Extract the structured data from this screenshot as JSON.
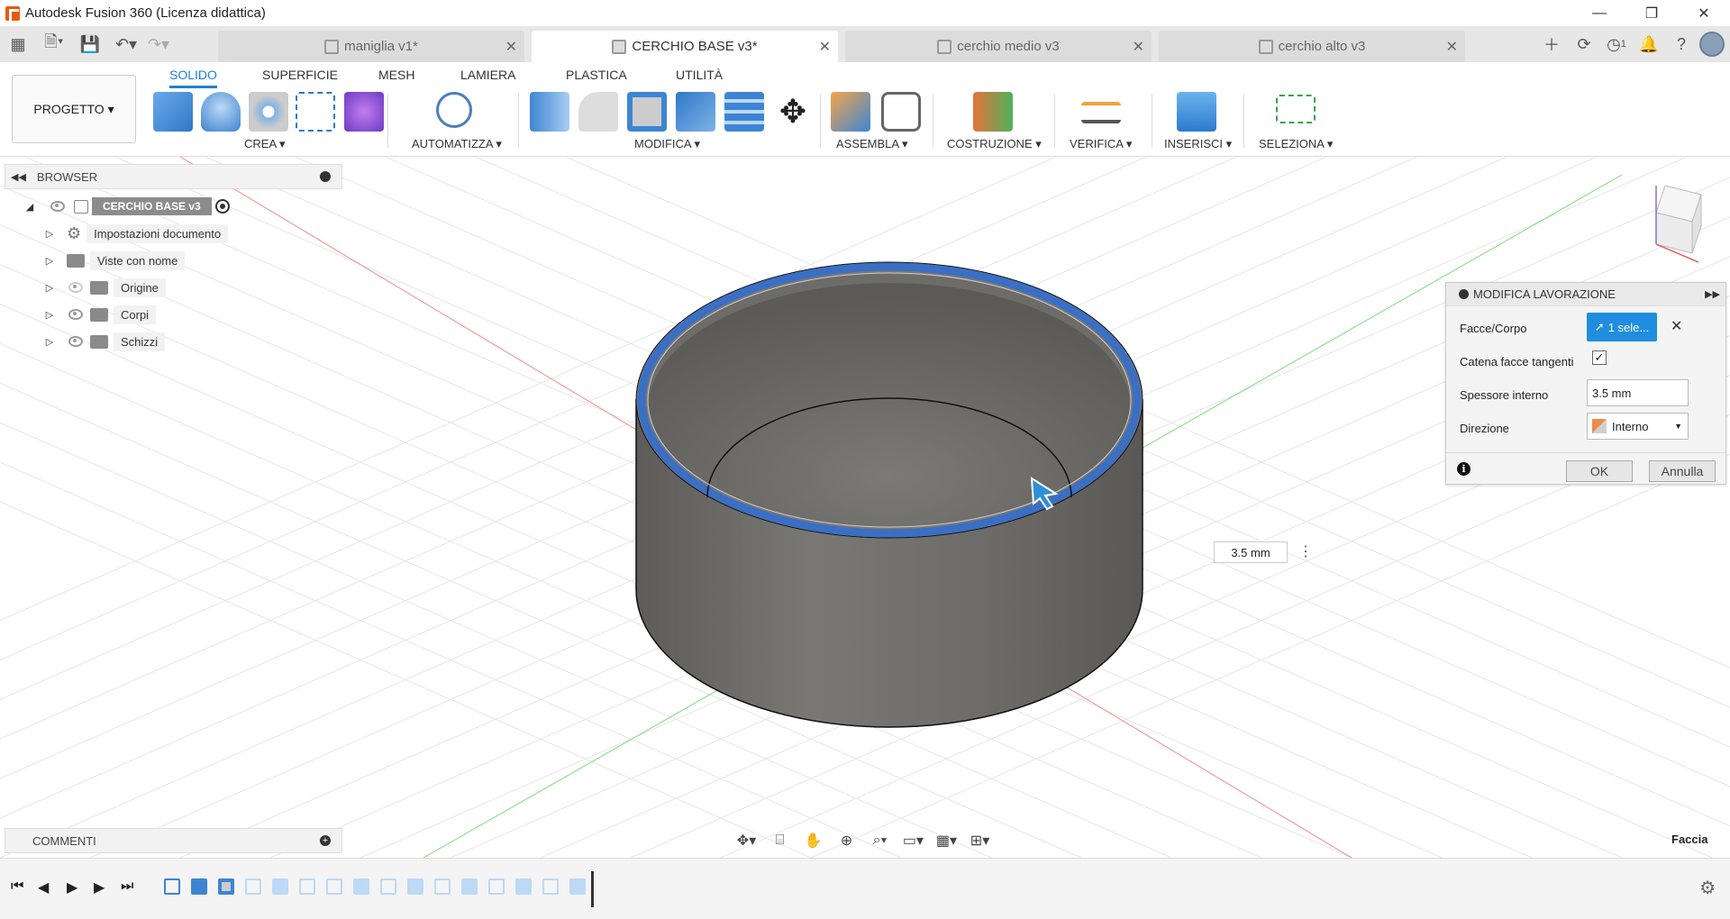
{
  "titlebar": {
    "title": "Autodesk Fusion 360 (Licenza didattica)",
    "controls": [
      "—",
      "❐",
      "✕"
    ]
  },
  "tabs": [
    {
      "label": "maniglia v1*",
      "active": false
    },
    {
      "label": "CERCHIO BASE v3*",
      "active": true
    },
    {
      "label": "cerchio medio v3",
      "active": false
    },
    {
      "label": "cerchio alto v3",
      "active": false
    }
  ],
  "toolbar_right": {
    "job_count": "1"
  },
  "ribbon": {
    "project_label": "PROGETTO ▾",
    "tabs": [
      "SOLIDO",
      "SUPERFICIE",
      "MESH",
      "LAMIERA",
      "PLASTICA",
      "UTILITÀ"
    ],
    "groups": [
      "CREA ▾",
      "AUTOMATIZZA ▾",
      "MODIFICA ▾",
      "ASSEMBLA ▾",
      "COSTRUZIONE ▾",
      "VERIFICA ▾",
      "INSERISCI ▾",
      "SELEZIONA ▾"
    ]
  },
  "browser": {
    "title": "BROWSER",
    "root": "CERCHIO BASE v3",
    "items": [
      {
        "label": "Impostazioni documento",
        "icon": "gear-icon"
      },
      {
        "label": "Viste con nome",
        "icon": "folder-icon"
      },
      {
        "label": "Origine",
        "icon": "folder-icon",
        "visibility": "hidden"
      },
      {
        "label": "Corpi",
        "icon": "folder-icon",
        "visibility": "visible"
      },
      {
        "label": "Schizzi",
        "icon": "folder-icon",
        "visibility": "visible"
      }
    ]
  },
  "comments": {
    "title": "COMMENTI"
  },
  "dialog": {
    "title": "MODIFICA LAVORAZIONE",
    "faces_label": "Facce/Corpo",
    "faces_value": "1 sele...",
    "tangent_label": "Catena facce tangenti",
    "tangent_checked": true,
    "thickness_label": "Spessore interno",
    "thickness_value": "3.5 mm",
    "direction_label": "Direzione",
    "direction_value": "Interno",
    "ok_label": "OK",
    "cancel_label": "Annulla"
  },
  "viewport": {
    "dimension_value": "3.5 mm",
    "selection_filter": "Faccia"
  },
  "colors": {
    "accent": "#1f7fd6",
    "selection_ring": "#3a6fc4",
    "body": "#6d6b67"
  }
}
